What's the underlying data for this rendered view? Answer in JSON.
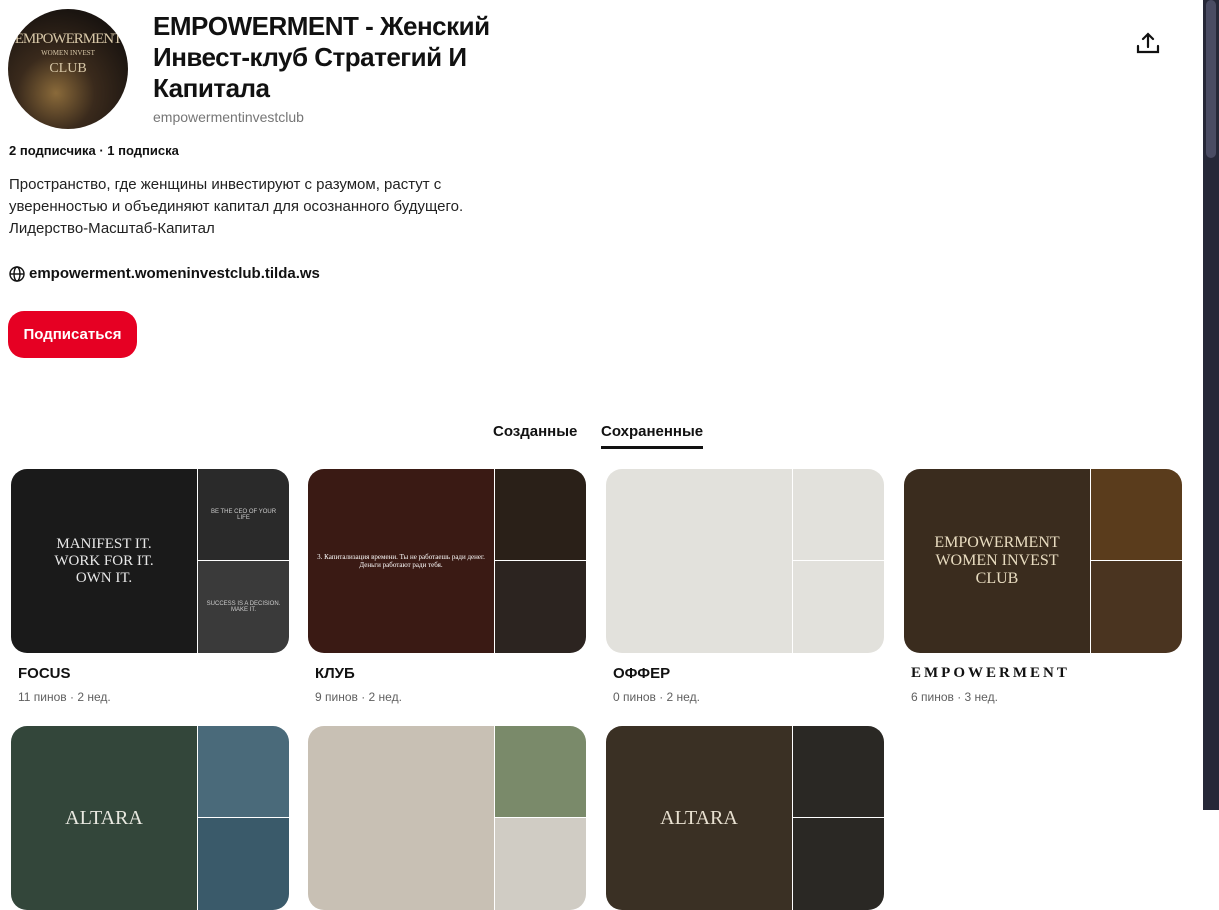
{
  "profile": {
    "avatar_text": [
      "EMPOWERMENT",
      "WOMEN INVEST",
      "CLUB"
    ],
    "title": "EMPOWERMENT - Женский Инвест-клуб Стратегий И Капитала",
    "handle": "empowermentinvestclub",
    "stats": "2 подписчика · 1 подписка",
    "bio": "Пространство, где женщины инвестируют с разумом, растут с\nуверенностью и объединяют капитал для осознанного будущего.\nЛидерство-Масштаб-Капитал",
    "website": "empowerment.womeninvestclub.tilda.ws",
    "follow_label": "Подписаться"
  },
  "tabs": [
    {
      "label": "Созданные"
    },
    {
      "label": "Сохраненные",
      "active": true
    }
  ],
  "boards": [
    {
      "title": "FOCUS",
      "meta": "11 пинов · 2 нед.",
      "cover_text": "MANIFEST IT.\nWORK FOR IT.\nOWN IT.",
      "side1": "BE THE CEO OF YOUR LIFE",
      "side2": "SUCCESS IS A DECISION. MAKE IT."
    },
    {
      "title": "КЛУБ",
      "meta": "9 пинов · 2 нед.",
      "cover_text": "3. Капитализация времени. Ты не работаешь ради денег. Деньги работают ради тебя.",
      "side1": "",
      "side2": ""
    },
    {
      "title": "ОФФЕР",
      "meta": "0 пинов · 2 нед.",
      "cover_text": "",
      "side1": "",
      "side2": ""
    },
    {
      "title": "EMPOWERMENT",
      "meta": "6 пинов · 3 нед.",
      "cover_text": "EMPOWERMENT\nWOMEN INVEST\nCLUB",
      "side1": "",
      "side2": ""
    },
    {
      "title": "",
      "meta": "",
      "cover_text": "ALTARA",
      "side1": "",
      "side2": ""
    },
    {
      "title": "",
      "meta": "",
      "cover_text": "",
      "side1": "",
      "side2": ""
    },
    {
      "title": "",
      "meta": "",
      "cover_text": "ALTARA",
      "side1": "",
      "side2": ""
    }
  ],
  "colors": {
    "accent": "#e60023",
    "scrollbar": "#262838"
  }
}
